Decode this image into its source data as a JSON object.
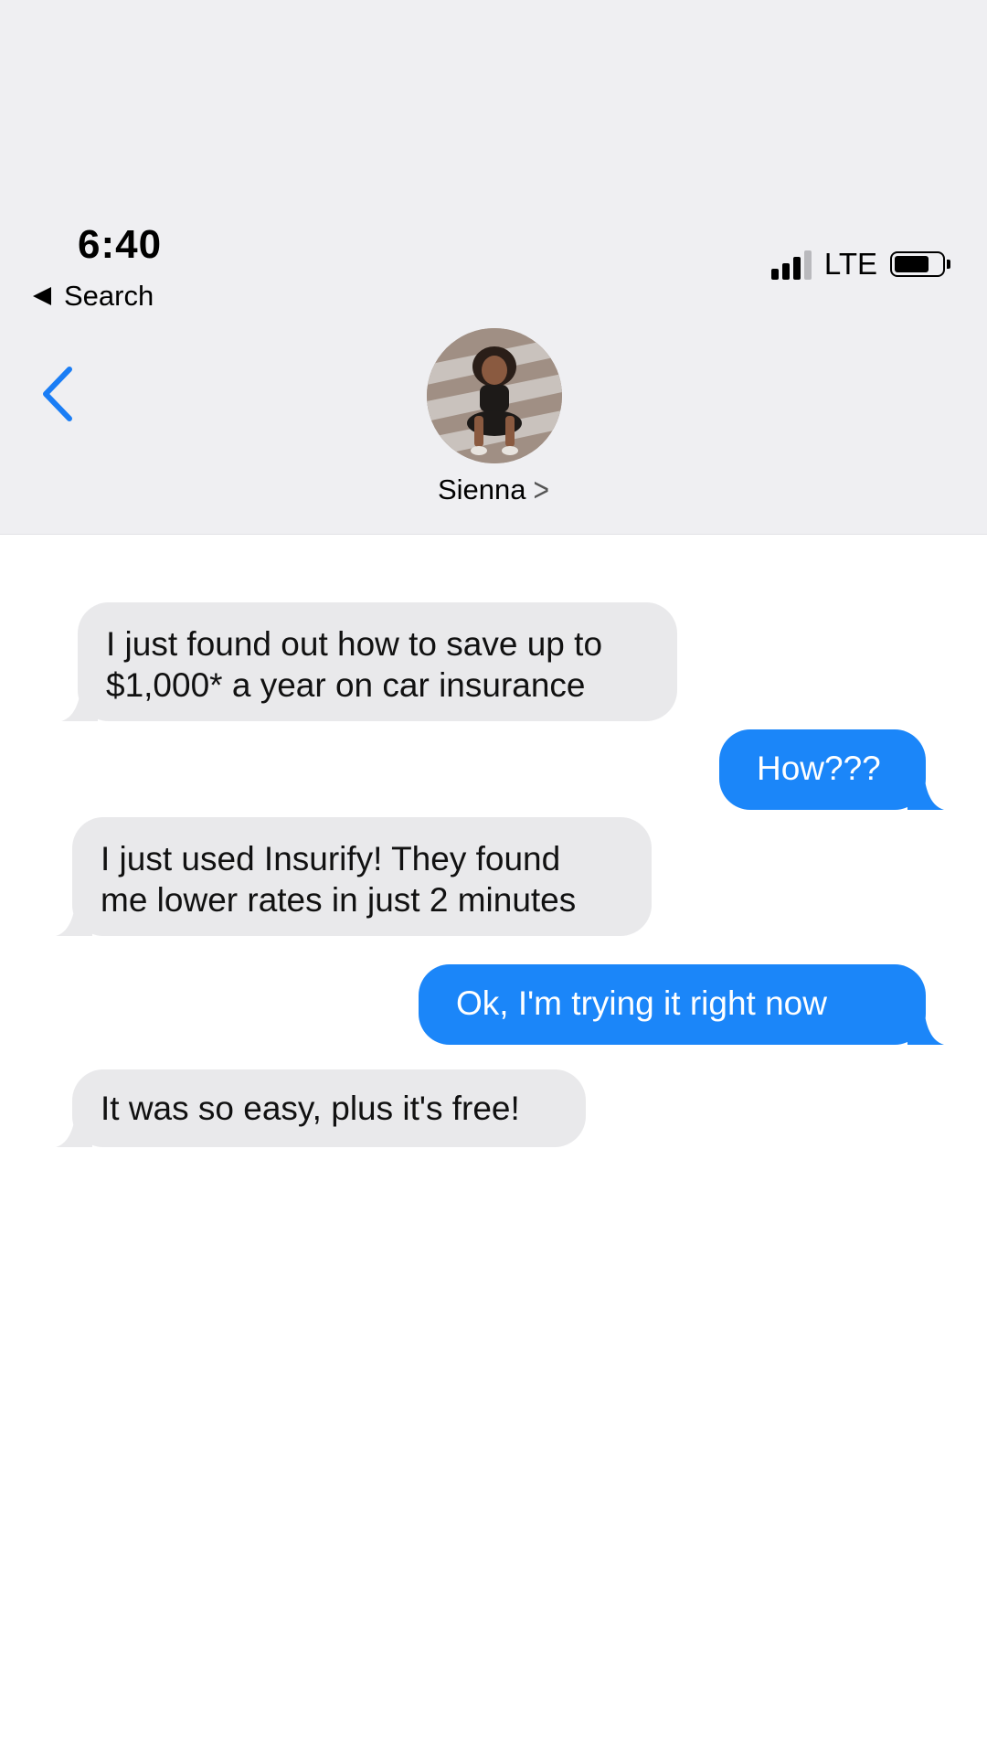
{
  "status_bar": {
    "time": "6:40",
    "back_app_label": "Search",
    "network": "LTE",
    "battery_level": 0.74
  },
  "contact": {
    "name": "Sienna",
    "avatar_icon": "contact-photo-icon"
  },
  "colors": {
    "incoming_bubble": "#e9e9eb",
    "outgoing_bubble": "#1b86f9",
    "accent": "#1a7df5",
    "header_bg": "#efeff2"
  },
  "messages": [
    {
      "direction": "incoming",
      "lines": [
        "I just found out how to save up to",
        "$1,000* a year on car insurance"
      ]
    },
    {
      "direction": "outgoing",
      "lines": [
        "How???"
      ]
    },
    {
      "direction": "incoming",
      "lines": [
        "I just used Insurify! They found",
        "me lower rates in just 2 minutes"
      ]
    },
    {
      "direction": "outgoing",
      "lines": [
        "Ok, I'm trying it right now"
      ]
    },
    {
      "direction": "incoming",
      "lines": [
        "It was so easy, plus it's free!"
      ]
    }
  ]
}
